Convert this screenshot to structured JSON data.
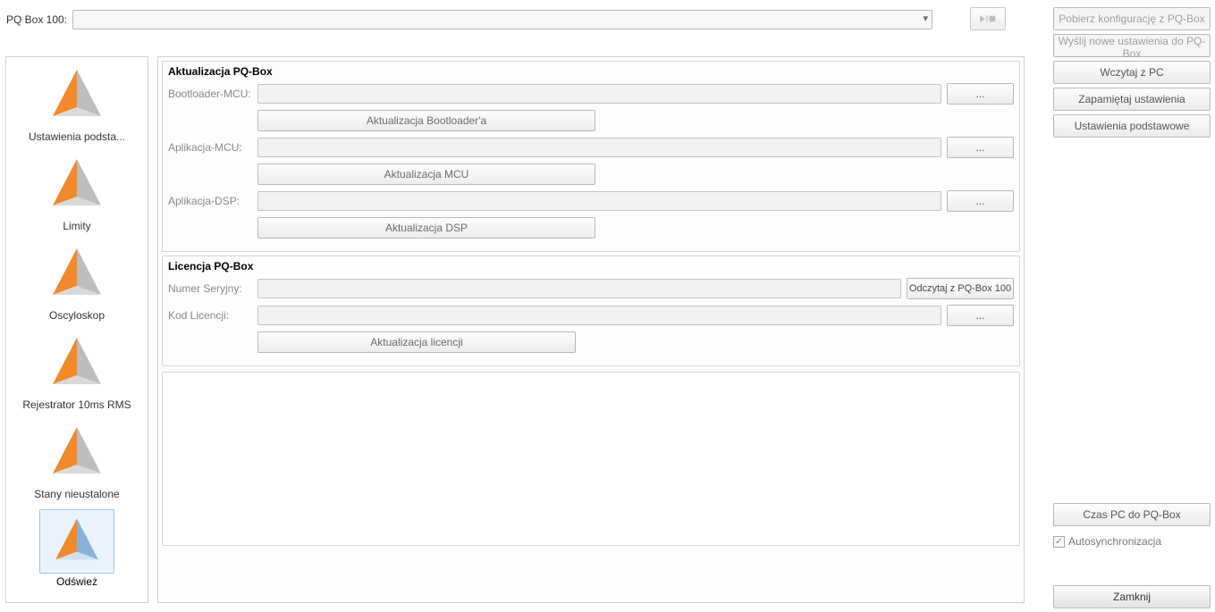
{
  "topbar": {
    "label": "PQ Box 100:",
    "selected": "",
    "play_tooltip": "Start/Stop"
  },
  "sidebar": {
    "items": [
      {
        "label": "Ustawienia podsta...",
        "variant": "orange"
      },
      {
        "label": "Limity",
        "variant": "orange"
      },
      {
        "label": "Oscyloskop",
        "variant": "orange"
      },
      {
        "label": "Rejestrator 10ms RMS",
        "variant": "orange"
      },
      {
        "label": "Stany nieustalone",
        "variant": "orange"
      },
      {
        "label": "Odśwież",
        "variant": "blue",
        "selected": true
      }
    ]
  },
  "group_update": {
    "title": "Aktualizacja PQ-Box",
    "bootloader_lbl": "Bootloader-MCU:",
    "bootloader_val": "",
    "bootloader_btn": "Aktualizacja Bootloader'a",
    "app_mcu_lbl": "Aplikacja-MCU:",
    "app_mcu_val": "",
    "app_mcu_btn": "Aktualizacja MCU",
    "app_dsp_lbl": "Aplikacja-DSP:",
    "app_dsp_val": "",
    "app_dsp_btn": "Aktualizacja DSP",
    "browse": "..."
  },
  "group_license": {
    "title": "Licencja PQ-Box",
    "serial_lbl": "Numer Seryjny:",
    "serial_val": "",
    "read_btn": "Odczytaj z PQ-Box 100",
    "code_lbl": "Kod Licencji:",
    "code_val": "",
    "update_btn": "Aktualizacja licencji",
    "browse": "..."
  },
  "right": {
    "fetch": "Pobierz konfigurację z PQ-Box",
    "send": "Wyślij nowe ustawienia do PQ-Box",
    "load": "Wczytaj z PC",
    "save": "Zapamiętaj ustawienia",
    "defaults": "Ustawienia podstawowe",
    "pc_time": "Czas PC do PQ-Box",
    "autosync": "Autosynchronizacja",
    "close": "Zamknij"
  }
}
